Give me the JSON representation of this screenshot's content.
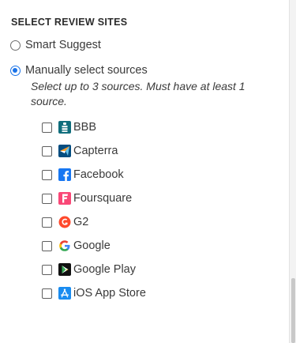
{
  "section": {
    "title": "SELECT REVIEW SITES"
  },
  "mode": {
    "options": [
      {
        "label": "Smart Suggest",
        "selected": false
      },
      {
        "label": "Manually select sources",
        "selected": true
      }
    ],
    "hint": "Select up to 3 sources. Must have at least 1 source."
  },
  "sources": [
    {
      "label": "BBB",
      "checked": false,
      "icon": "bbb-icon"
    },
    {
      "label": "Capterra",
      "checked": false,
      "icon": "capterra-icon"
    },
    {
      "label": "Facebook",
      "checked": false,
      "icon": "facebook-icon"
    },
    {
      "label": "Foursquare",
      "checked": false,
      "icon": "foursquare-icon"
    },
    {
      "label": "G2",
      "checked": false,
      "icon": "g2-icon"
    },
    {
      "label": "Google",
      "checked": false,
      "icon": "google-icon"
    },
    {
      "label": "Google Play",
      "checked": false,
      "icon": "google-play-icon"
    },
    {
      "label": "iOS App Store",
      "checked": false,
      "icon": "ios-app-store-icon"
    }
  ],
  "colors": {
    "accent": "#1a73e8",
    "bbb": "#0f6d7c",
    "capterra": "#044d80",
    "facebook": "#1877f2",
    "foursquare": "#f94877",
    "g2": "#ff492c",
    "app_store": "#1a8cf0"
  }
}
